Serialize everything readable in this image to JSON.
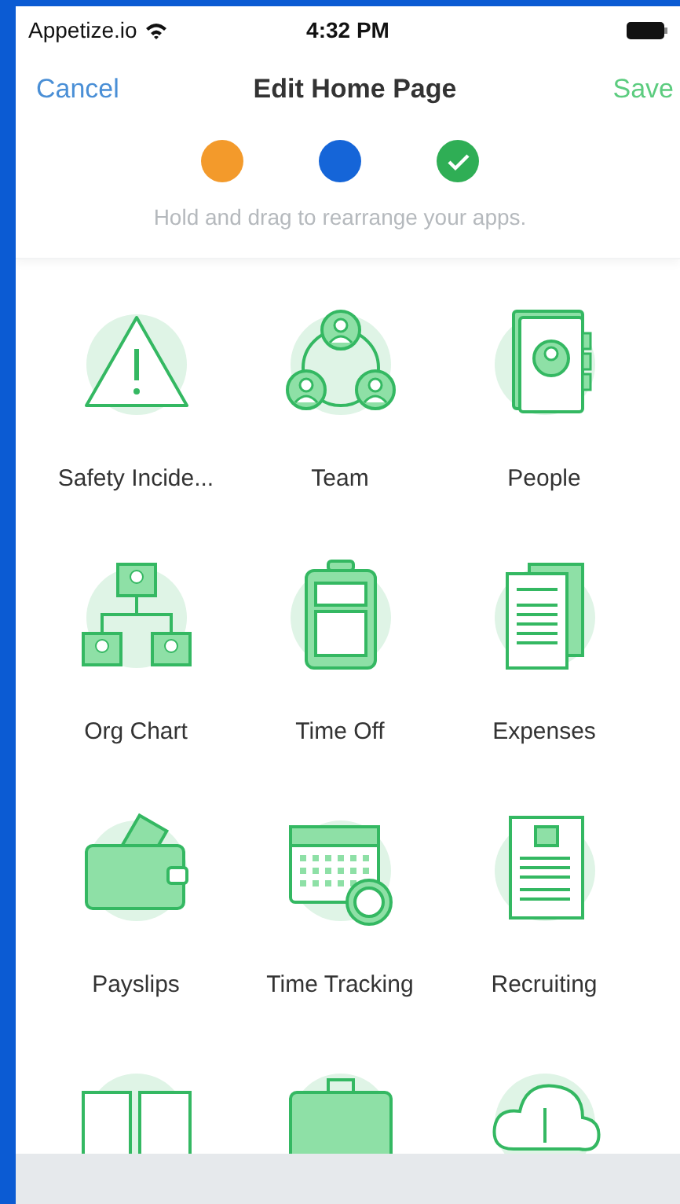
{
  "status_bar": {
    "carrier": "Appetize.io",
    "time": "4:32 PM"
  },
  "nav": {
    "cancel": "Cancel",
    "title": "Edit Home Page",
    "save": "Save"
  },
  "steps": [
    {
      "color": "#f39a2b",
      "checked": false
    },
    {
      "color": "#1565d8",
      "checked": false
    },
    {
      "color": "#2fae55",
      "checked": true
    }
  ],
  "hint": "Hold and drag to rearrange your apps.",
  "apps": [
    {
      "kind": "warning",
      "label": "Safety Incide..."
    },
    {
      "kind": "team",
      "label": "Team"
    },
    {
      "kind": "contacts",
      "label": "People"
    },
    {
      "kind": "org",
      "label": "Org Chart"
    },
    {
      "kind": "luggage",
      "label": "Time Off"
    },
    {
      "kind": "receipt",
      "label": "Expenses"
    },
    {
      "kind": "wallet",
      "label": "Payslips"
    },
    {
      "kind": "calendar",
      "label": "Time Tracking"
    },
    {
      "kind": "resume",
      "label": "Recruiting"
    },
    {
      "kind": "pictures"
    },
    {
      "kind": "briefcase"
    },
    {
      "kind": "cloud"
    }
  ]
}
